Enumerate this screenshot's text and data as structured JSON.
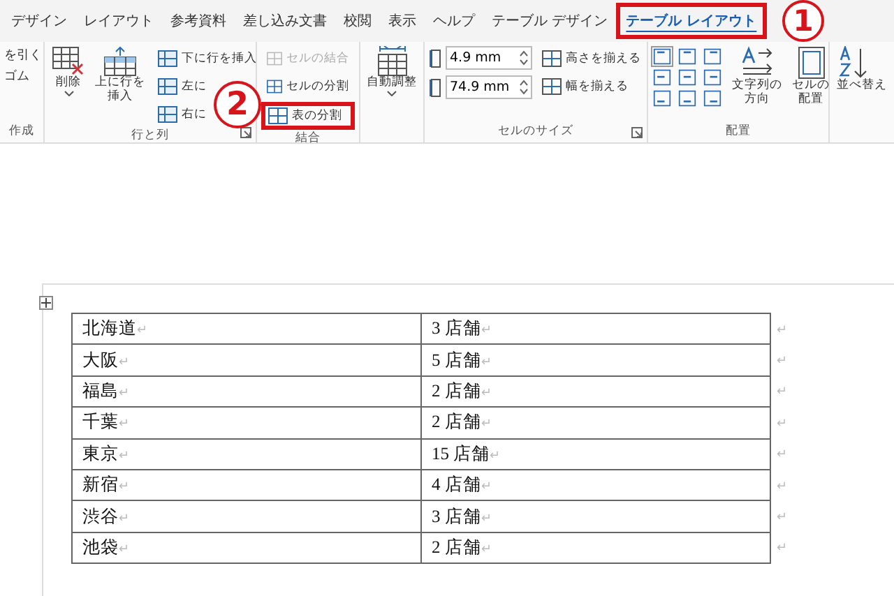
{
  "tabs": [
    {
      "label": "デザイン",
      "selected": false,
      "highlighted": false
    },
    {
      "label": "レイアウト",
      "selected": false,
      "highlighted": false
    },
    {
      "label": "参考資料",
      "selected": false,
      "highlighted": false
    },
    {
      "label": "差し込み文書",
      "selected": false,
      "highlighted": false
    },
    {
      "label": "校閲",
      "selected": false,
      "highlighted": false
    },
    {
      "label": "表示",
      "selected": false,
      "highlighted": false
    },
    {
      "label": "ヘルプ",
      "selected": false,
      "highlighted": false
    },
    {
      "label": "テーブル デザイン",
      "selected": false,
      "highlighted": false
    },
    {
      "label": "テーブル レイアウト",
      "selected": true,
      "highlighted": true
    }
  ],
  "ribbon": {
    "draw_group": {
      "items": [
        "を引く",
        "ゴム"
      ],
      "label": "作成"
    },
    "rows_columns": {
      "delete": "削除",
      "insert_above": [
        "上に行を",
        "挿入"
      ],
      "small_buttons": [
        "下に行を挿入",
        "左に",
        "右に"
      ],
      "label": "行と列"
    },
    "merge": {
      "buttons": [
        {
          "label": "セルの結合",
          "disabled": true,
          "highlighted": false
        },
        {
          "label": "セルの分割",
          "disabled": false,
          "highlighted": false
        },
        {
          "label": "表の分割",
          "disabled": false,
          "highlighted": true
        }
      ],
      "label": "結合"
    },
    "autofit": {
      "label": "自動調整"
    },
    "cell_size": {
      "height": "4.9 mm",
      "width": "74.9 mm",
      "distribute": [
        "高さを揃える",
        "幅を揃える"
      ],
      "label": "セルのサイズ"
    },
    "alignment": {
      "text_direction": [
        "文字列の",
        "方向"
      ],
      "cell_margins": [
        "セルの",
        "配置"
      ],
      "label": "配置"
    },
    "sort": {
      "label": "並べ替え"
    }
  },
  "callouts": [
    "1",
    "2"
  ],
  "table": {
    "rows": [
      {
        "cells": [
          {
            "text": "北海道",
            "mark": "↵"
          },
          {
            "text": "3 店舗",
            "mark": "↵"
          }
        ],
        "end_mark": "↵"
      },
      {
        "cells": [
          {
            "text": "大阪",
            "mark": "↵"
          },
          {
            "text": "5 店舗",
            "mark": "↵"
          }
        ],
        "end_mark": "↵"
      },
      {
        "cells": [
          {
            "text": "福島",
            "mark": "↵"
          },
          {
            "text": "2 店舗",
            "mark": "↵"
          }
        ],
        "end_mark": "↵"
      },
      {
        "cells": [
          {
            "text": "千葉",
            "mark": "↵"
          },
          {
            "text": "2 店舗",
            "mark": "↵"
          }
        ],
        "end_mark": "↵"
      },
      {
        "cells": [
          {
            "text": "東京",
            "mark": "↵"
          },
          {
            "text": "15 店舗",
            "mark": "↵"
          }
        ],
        "end_mark": "↵"
      },
      {
        "cells": [
          {
            "text": "新宿",
            "mark": "↵"
          },
          {
            "text": "4 店舗",
            "mark": "↵"
          }
        ],
        "end_mark": "↵"
      },
      {
        "cells": [
          {
            "text": "渋谷",
            "mark": "↵"
          },
          {
            "text": "3 店舗",
            "mark": "↵"
          }
        ],
        "end_mark": "↵"
      },
      {
        "cells": [
          {
            "text": "池袋",
            "mark": "↵"
          },
          {
            "text": "2 店舗",
            "mark": "↵"
          }
        ],
        "end_mark": "↵"
      }
    ]
  }
}
